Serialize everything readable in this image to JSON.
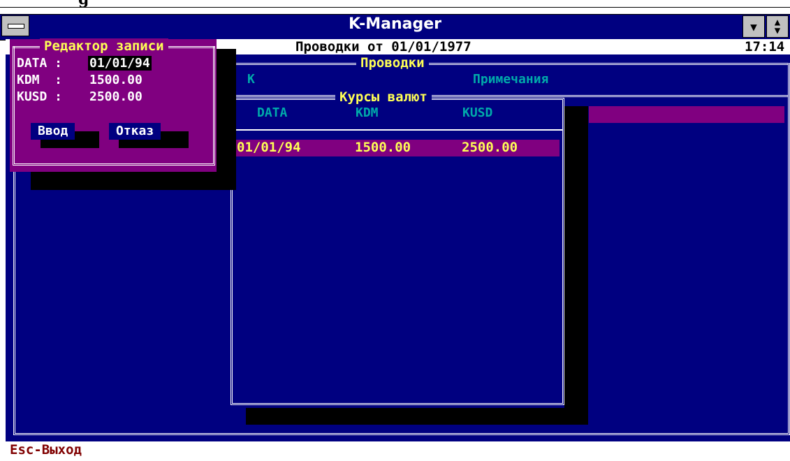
{
  "app": {
    "title": "K-Manager",
    "header_fragment": "g"
  },
  "infobar": {
    "postings_date_label": "Проводки от 01/01/1977",
    "clock": "17:14"
  },
  "postings_window": {
    "title": "Проводки",
    "columns": [
      "К",
      "Примечания"
    ]
  },
  "rates_window": {
    "title": "Курсы валют",
    "columns": [
      "DATA",
      "KDM",
      "KUSD"
    ],
    "rows": [
      {
        "data": "01/01/94",
        "kdm": "1500.00",
        "kusd": "2500.00"
      }
    ]
  },
  "editor_dialog": {
    "title": "Редактор записи",
    "fields": [
      {
        "label": "DATA :",
        "value": "01/01/94"
      },
      {
        "label": "KDM  :",
        "value": "1500.00"
      },
      {
        "label": "KUSD :",
        "value": "2500.00"
      }
    ],
    "buttons": {
      "ok": "Ввод",
      "cancel": "Отказ"
    }
  },
  "statusbar": {
    "hint": "Esc-Выход"
  },
  "colors": {
    "background": "#000080",
    "dialog": "#800080",
    "highlight": "#800080",
    "title_text": "#ffff55",
    "column_text": "#00aaaa",
    "status_text": "#800000"
  }
}
